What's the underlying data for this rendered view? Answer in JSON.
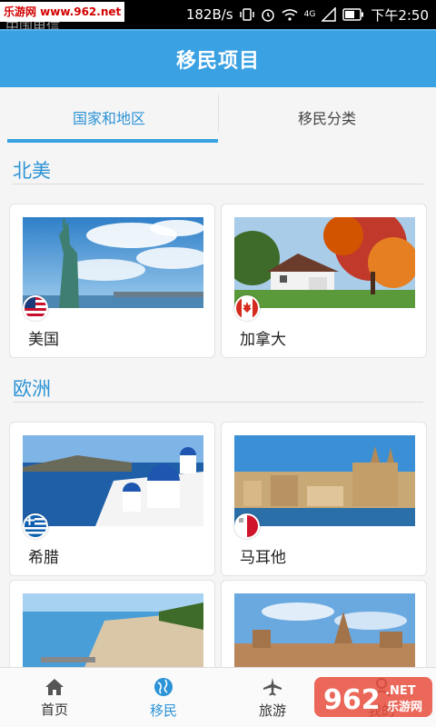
{
  "status": {
    "watermark_tag": "乐游网 www.962.net",
    "carrier": "中国电信",
    "speed": "182B/s",
    "network": "4G",
    "time": "下午2:50"
  },
  "header": {
    "title": "移民项目"
  },
  "tabs": [
    {
      "label": "国家和地区",
      "active": true
    },
    {
      "label": "移民分类",
      "active": false
    }
  ],
  "sections": [
    {
      "title": "北美",
      "countries": [
        {
          "name": "美国",
          "flag": "us-flag-icon"
        },
        {
          "name": "加拿大",
          "flag": "canada-flag-icon"
        }
      ]
    },
    {
      "title": "欧洲",
      "countries": [
        {
          "name": "希腊",
          "flag": "greece-flag-icon"
        },
        {
          "name": "马耳他",
          "flag": "malta-flag-icon"
        }
      ]
    }
  ],
  "bottom_nav": [
    {
      "label": "首页",
      "icon": "home-icon",
      "active": false
    },
    {
      "label": "移民",
      "icon": "globe-icon",
      "active": true
    },
    {
      "label": "旅游",
      "icon": "airplane-icon",
      "active": false
    },
    {
      "label": "我的",
      "icon": "user-icon",
      "active": false
    }
  ],
  "overlay_watermark": {
    "text": "962",
    "sub": "乐游网",
    "suffix": ".NET"
  },
  "colors": {
    "accent": "#3aa1e2",
    "accent_text": "#2b93d6",
    "background": "#f5f5f5"
  }
}
